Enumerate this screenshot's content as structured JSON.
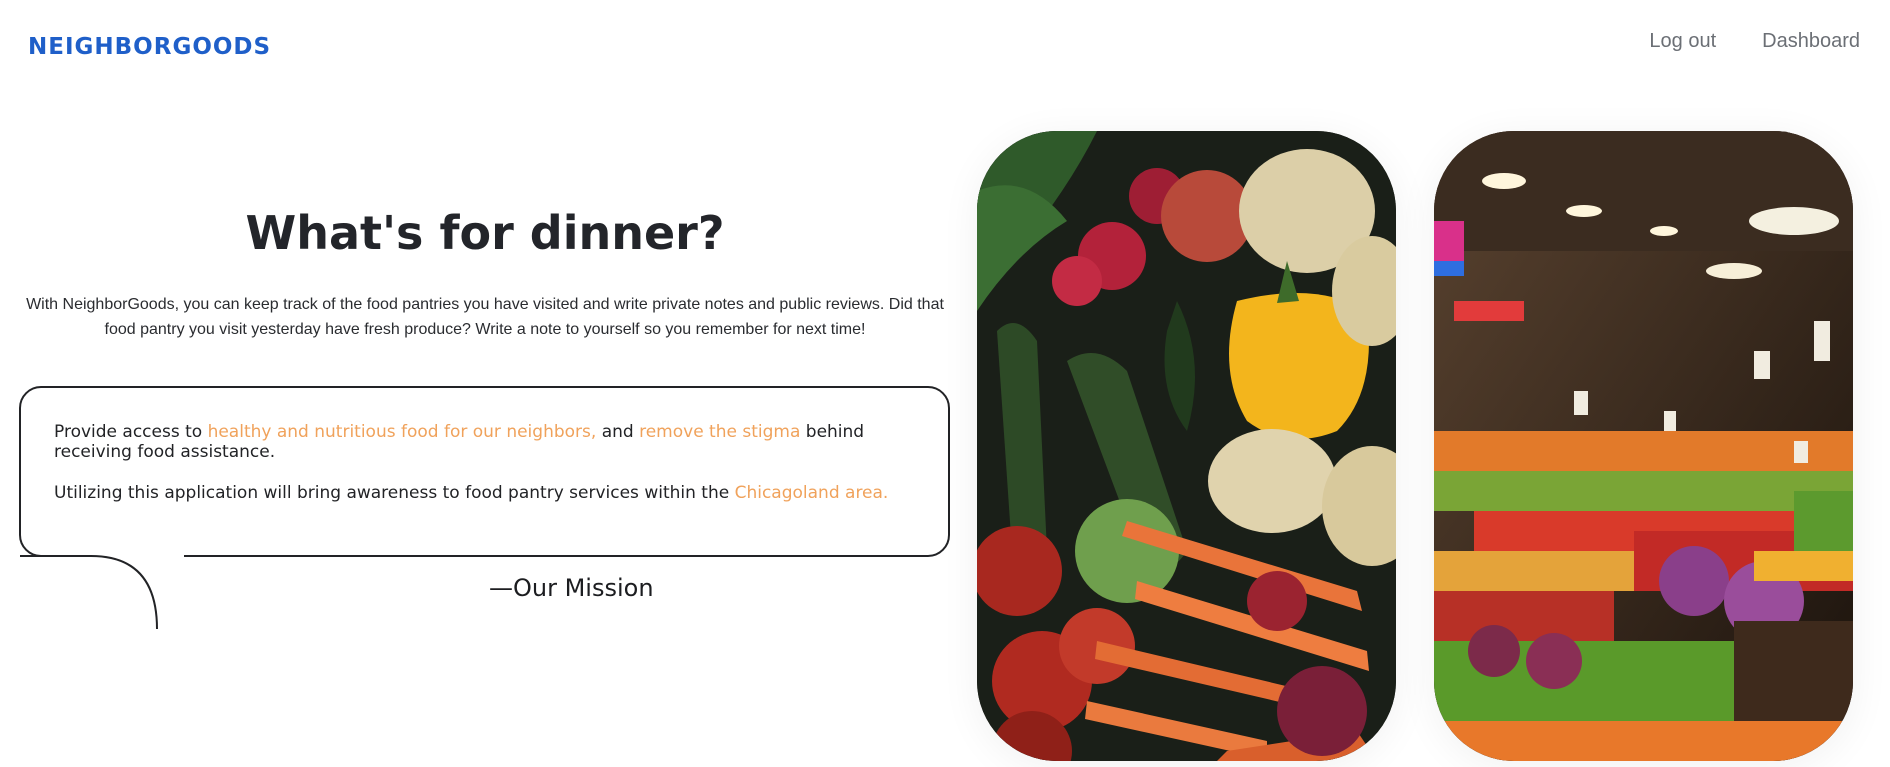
{
  "header": {
    "brand": "NEIGHBORGOODS",
    "nav": [
      {
        "label": "Log out"
      },
      {
        "label": "Dashboard"
      }
    ]
  },
  "hero": {
    "title": "What's for dinner?",
    "description": "With NeighborGoods, you can keep track of the food pantries you have visited and write private notes and public reviews. Did that food pantry you visit yesterday have fresh produce? Write a note to yourself so you remember for next time!"
  },
  "mission": {
    "p1_a": "Provide access to ",
    "p1_hl1": "healthy and nutritious food for our neighbors,",
    "p1_b": " and ",
    "p1_hl2": "remove the stigma",
    "p1_c": " behind receiving food assistance.",
    "p2_a": "Utilizing this application will bring awareness to food pantry services within the ",
    "p2_hl": "Chicagoland area.",
    "signature": "—Our Mission"
  },
  "colors": {
    "brand": "#1f5fc9",
    "highlight": "#f0a25b",
    "text": "#222326",
    "nav": "#6b6f75"
  },
  "images": [
    {
      "name": "vegetables-photo"
    },
    {
      "name": "market-produce-photo"
    }
  ]
}
